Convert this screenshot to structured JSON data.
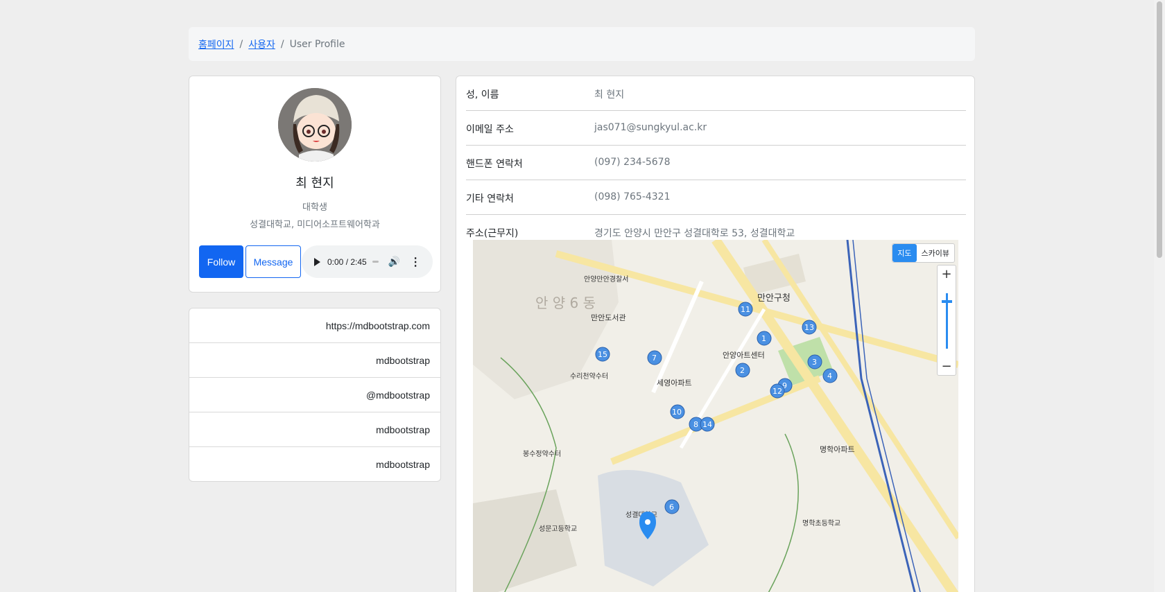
{
  "breadcrumb": {
    "home": "홈페이지",
    "users": "사용자",
    "current": "User Profile"
  },
  "profile": {
    "name": "최 현지",
    "role": "대학생",
    "school": "성결대학교, 미디어소프트웨어학과",
    "follow_label": "Follow",
    "message_label": "Message",
    "audio_time": "0:00 / 2:45"
  },
  "links": [
    "https://mdbootstrap.com",
    "mdbootstrap",
    "@mdbootstrap",
    "mdbootstrap",
    "mdbootstrap"
  ],
  "info": {
    "name_label": "성, 이름",
    "name_value": "최 현지",
    "email_label": "이메일 주소",
    "email_value": "jas071@sungkyul.ac.kr",
    "phone_label": "핸드폰 연락처",
    "phone_value": "(097) 234-5678",
    "other_label": "기타 연락처",
    "other_value": "(098) 765-4321",
    "address_label": "주소(근무지)",
    "address_value": "경기도 안양시 만안구 성결대학로 53, 성결대학교"
  },
  "map": {
    "toggle_map": "지도",
    "toggle_sky": "스카이뷰",
    "district": "안 양 6 동",
    "places": [
      "만안구청",
      "안양아트센터",
      "만안도서관",
      "세영아파트",
      "성결대학교",
      "명학아파트",
      "안양만안경찰서",
      "수리천약수터",
      "봉수정약수터",
      "명학초등학교",
      "성문고등학교"
    ],
    "markers": [
      "1",
      "2",
      "3",
      "4",
      "6",
      "7",
      "8",
      "9",
      "10",
      "11",
      "12",
      "13",
      "14",
      "15"
    ]
  }
}
